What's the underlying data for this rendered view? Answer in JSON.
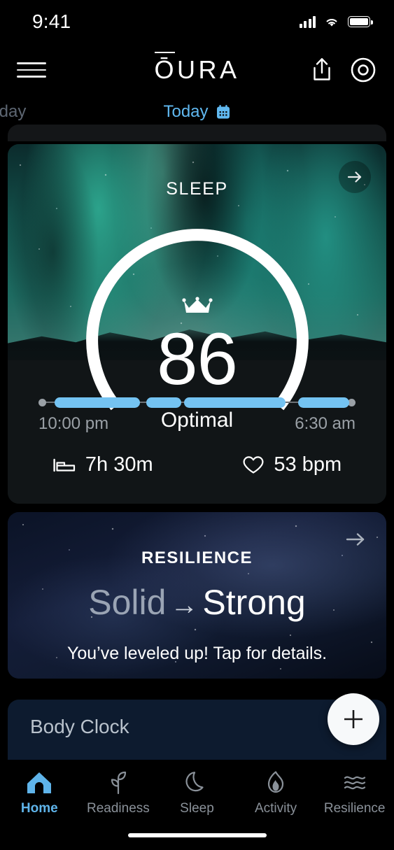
{
  "status_bar": {
    "time": "9:41",
    "cellular_icon": "cellular-signal-icon",
    "wifi_icon": "wifi-icon",
    "battery_icon": "battery-icon"
  },
  "app_header": {
    "menu_icon": "hamburger-menu-icon",
    "brand_first": "Ō",
    "brand_rest": "URA",
    "share_icon": "share-icon",
    "ring_icon": "ring-icon"
  },
  "day_tabs": {
    "yesterday_label": "rday",
    "today_label": "Today",
    "today_calendar_icon": "calendar-icon",
    "active": "Today",
    "active_color": "#60b8f0"
  },
  "sleep_card": {
    "title": "SLEEP",
    "arrow_icon": "arrow-right-icon",
    "crown_icon": "crown-icon",
    "score": "86",
    "score_label": "Optimal",
    "gauge": {
      "value": 86,
      "max": 100,
      "track_color": "#53585b",
      "fill_color": "#ffffff"
    },
    "timeline": {
      "start_time": "10:00 pm",
      "end_time": "6:30 am",
      "segment_color": "#74c3f2",
      "segments": [
        {
          "left_pct": 5,
          "width_pct": 27
        },
        {
          "left_pct": 34,
          "width_pct": 11
        },
        {
          "left_pct": 46,
          "width_pct": 32
        },
        {
          "left_pct": 82,
          "width_pct": 16
        }
      ]
    },
    "duration_icon": "bed-icon",
    "duration": "7h 30m",
    "heart_icon": "heart-icon",
    "heart_rate": "53 bpm"
  },
  "resilience_card": {
    "title": "RESILIENCE",
    "arrow_icon": "arrow-right-icon",
    "level_from": "Solid",
    "level_glyph": "→",
    "level_to": "Strong",
    "subtitle": "You’ve leveled up! Tap for details."
  },
  "body_clock_card": {
    "title": "Body Clock"
  },
  "fab": {
    "icon": "plus-icon",
    "label": "+"
  },
  "bottom_nav": {
    "items": [
      {
        "label": "Home",
        "icon": "home-icon",
        "active": true
      },
      {
        "label": "Readiness",
        "icon": "sprout-icon",
        "active": false
      },
      {
        "label": "Sleep",
        "icon": "moon-icon",
        "active": false
      },
      {
        "label": "Activity",
        "icon": "flame-icon",
        "active": false
      },
      {
        "label": "Resilience",
        "icon": "waves-icon",
        "active": false
      }
    ]
  }
}
